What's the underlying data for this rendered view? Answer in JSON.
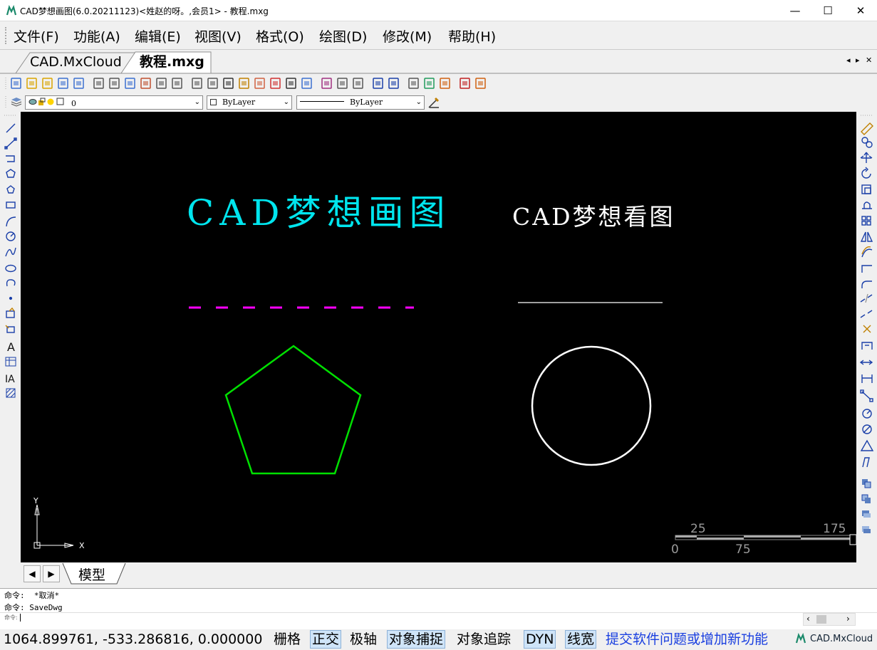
{
  "window": {
    "title": "CAD梦想画图(6.0.20211123)<姓赵的呀。,会员1> - 教程.mxg",
    "minimize": "—",
    "maximize": "☐",
    "close": "✕"
  },
  "menu": {
    "items": [
      "文件(F)",
      "功能(A)",
      "编辑(E)",
      "视图(V)",
      "格式(O)",
      "绘图(D)",
      "修改(M)",
      "帮助(H)"
    ]
  },
  "tabs": {
    "items": [
      "CAD.MxCloud",
      "教程.mxg"
    ],
    "nav_left": "◂",
    "nav_right": "▸",
    "close": "✕"
  },
  "layer_bar": {
    "layer_value": "0",
    "color_value": "ByLayer",
    "linetype_value": "ByLayer"
  },
  "drawing": {
    "text1": "CAD梦想画图",
    "text2": "CAD梦想看图",
    "ucs_x": "X",
    "ucs_y": "Y",
    "scale_labels_top": [
      "25",
      "175"
    ],
    "scale_labels_bottom": [
      "0",
      "75"
    ],
    "colors": {
      "cyan_text": "#00e5ee",
      "magenta_line": "#ff00ff",
      "pentagon": "#00e000",
      "white": "#ffffff"
    }
  },
  "sheet_tabs": {
    "prev": "◀",
    "next": "▶",
    "model": "模型"
  },
  "command": {
    "lines": [
      "命令:  *取消*",
      "命令: SaveDwg"
    ],
    "prompt": "命令:"
  },
  "status": {
    "coords": "1064.899761,  -533.286816,  0.000000",
    "grid": "栅格",
    "ortho": "正交",
    "polar": "极轴",
    "osnap": "对象捕捉",
    "otrack": "对象追踪",
    "dyn": "DYN",
    "lweight": "线宽",
    "feedback": "提交软件问题或增加新功能",
    "brand": "CAD.MxCloud"
  }
}
